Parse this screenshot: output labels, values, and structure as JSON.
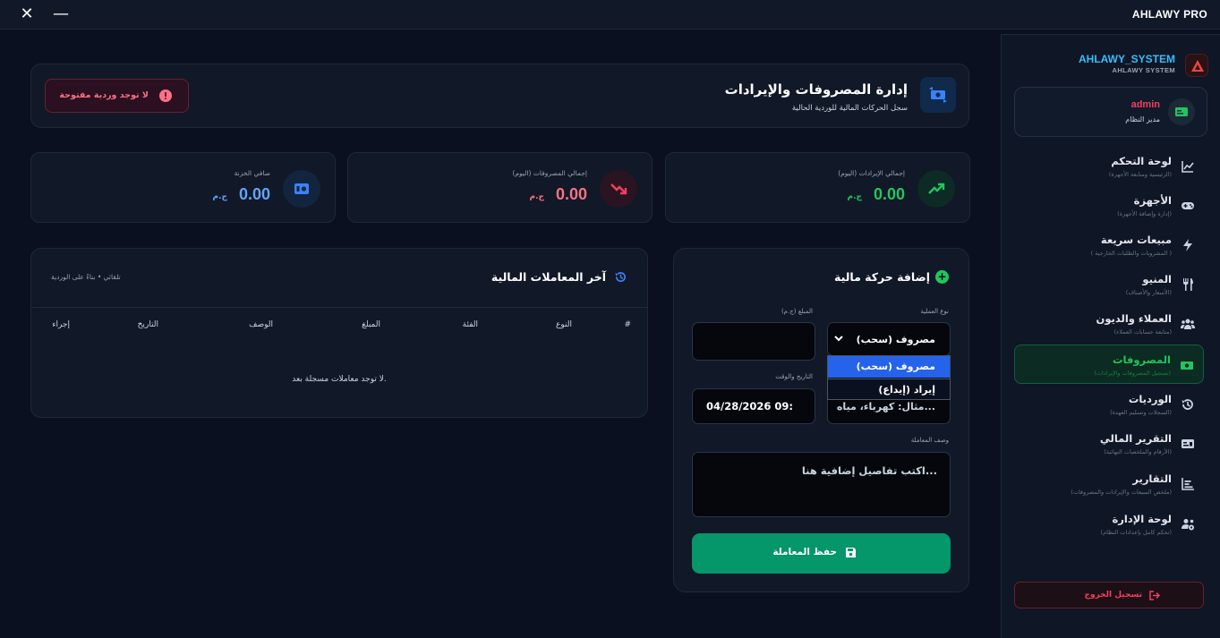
{
  "titlebar": {
    "app_title": "AHLAWY PRO",
    "close_glyph": "✕",
    "minimize_glyph": "—"
  },
  "brand": {
    "name": "AHLAWY_SYSTEM",
    "sub": "AHLAWY SYSTEM"
  },
  "user": {
    "name": "admin",
    "role": "مدير النظام"
  },
  "nav": [
    {
      "label": "لوحة التحكم",
      "sub": "(الرئيسية ومتابعة الأجهزة)",
      "icon": "chart-line-icon"
    },
    {
      "label": "الأجهزة",
      "sub": "(إدارة وإضافة الأجهزة)",
      "icon": "gamepad-icon"
    },
    {
      "label": "مبيعات سريعة",
      "sub": "( المشروبات والطلبات الخارجية )",
      "icon": "bolt-icon"
    },
    {
      "label": "المنيو",
      "sub": "(الأسعار والأصناف)",
      "icon": "utensils-icon"
    },
    {
      "label": "العملاء والديون",
      "sub": "(متابعة حسابات العملاء)",
      "icon": "users-icon"
    },
    {
      "label": "المصروفات",
      "sub": "(تسجيل المصروفات والإيرادات)",
      "icon": "money-icon"
    },
    {
      "label": "الورديات",
      "sub": "(السجلات وتسليم العهدة)",
      "icon": "history-icon"
    },
    {
      "label": "التقرير المالي",
      "sub": "(الأرقام والملخصات النهائية)",
      "icon": "id-card-icon"
    },
    {
      "label": "التقارير",
      "sub": "(ملخص المبيعات والإيرادات والمصروفات)",
      "icon": "bar-chart-icon"
    },
    {
      "label": "لوحة الإدارة",
      "sub": "(تحكم كامل بإعدادات النظام)",
      "icon": "users-cog-icon"
    }
  ],
  "logout_label": "تسجيل الخروج",
  "header": {
    "title": "إدارة المصروفات والإيرادات",
    "sub": "سجل الحركات المالية للوردية الحالية",
    "shift_badge": "لا توجد وردية مفتوحة"
  },
  "stats": [
    {
      "label": "إجمالي الإيرادات (اليوم)",
      "value": "0.00",
      "currency": "ج.م",
      "color": "#22c55e",
      "icon": "trend-up-icon"
    },
    {
      "label": "إجمالي المصروفات (اليوم)",
      "value": "0.00",
      "currency": "ج.م",
      "color": "#fb7185",
      "icon": "trend-down-icon"
    },
    {
      "label": "صافي الخزنة",
      "value": "0.00",
      "currency": "ج.م",
      "color": "#60a5fa",
      "icon": "cash-register-icon"
    }
  ],
  "transactions": {
    "title": "آخر المعاملات المالية",
    "note": "تلقائي • بناءً على الوردية",
    "columns": [
      "#",
      "النوع",
      "الفئة",
      "المبلغ",
      "الوصف",
      "التاريخ",
      "إجراء"
    ],
    "empty": "لا توجد معاملات مسجلة بعد."
  },
  "form": {
    "title": "إضافة حركة مالية",
    "type_label": "نوع العملية",
    "type_value": "مصروف (سحب)",
    "type_options": [
      "مصروف (سحب)",
      "إيراد (إيداع)"
    ],
    "amount_label": "المبلغ (ج.م)",
    "amount_value": "",
    "datetime_label": "التاريخ والوقت",
    "datetime_value": "04/28/2026 09:",
    "category_placeholder": "مثال: كهرباء، مياه...",
    "desc_label": "وصف المعاملة",
    "desc_placeholder": "اكتب تفاصيل إضافية هنا...",
    "save_label": "حفظ المعاملة"
  },
  "colors": {
    "accent_green": "#059669",
    "danger": "#f43f5e",
    "info": "#38bdf8"
  }
}
